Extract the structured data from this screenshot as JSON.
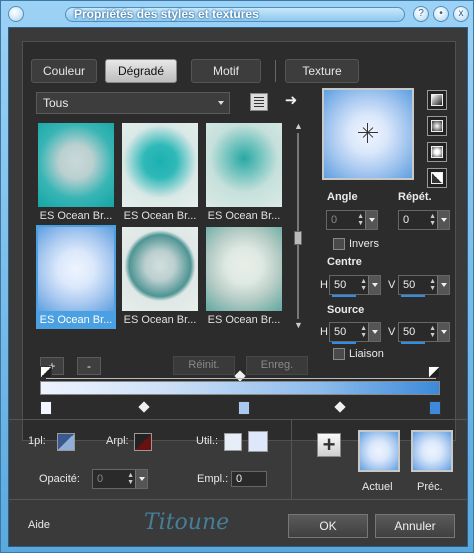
{
  "window": {
    "title": "Propriétés des styles et textures",
    "controls": [
      "help-icon",
      "pin-icon",
      "close-icon"
    ],
    "close_glyph": "x",
    "help_glyph": "?"
  },
  "tabs": [
    {
      "label": "Couleur"
    },
    {
      "label": "Dégradé"
    },
    {
      "label": "Motif"
    },
    {
      "label": "Texture"
    }
  ],
  "active_tab": "Dégradé",
  "category_select": {
    "value": "Tous"
  },
  "gradients": [
    {
      "name": "ES Ocean Br..."
    },
    {
      "name": "ES Ocean Br..."
    },
    {
      "name": "ES Ocean Br..."
    },
    {
      "name": "ES Ocean Br..."
    },
    {
      "name": "ES Ocean Br..."
    },
    {
      "name": "ES Ocean Br..."
    }
  ],
  "selected_gradient_index": 3,
  "angle": {
    "label": "Angle",
    "value": "0"
  },
  "repeat": {
    "label": "Répét.",
    "value": "0"
  },
  "invert": {
    "label": "Invers",
    "checked": false
  },
  "center": {
    "label": "Centre",
    "h_label": "H",
    "h_value": "50",
    "v_label": "V",
    "v_value": "50"
  },
  "source": {
    "label": "Source",
    "h_label": "H",
    "h_value": "50",
    "v_label": "V",
    "v_value": "50"
  },
  "link": {
    "label": "Liaison",
    "checked": false
  },
  "buttons": {
    "add": "+",
    "remove": "-",
    "reset": "Réinit.",
    "save": "Enreg."
  },
  "bottom": {
    "first_plan_label": "1pl:",
    "background_label": "Arpl:",
    "user_label": "Util.:",
    "opacity_label": "Opacité:",
    "opacity_value": "0",
    "location_label": "Empl.:",
    "location_value": "0",
    "current_label": "Actuel",
    "previous_label": "Préc.",
    "help_label": "Aide",
    "ok_label": "OK",
    "cancel_label": "Annuler",
    "plus_glyph": "+",
    "signature": "Titoune"
  },
  "colors": {
    "accent": "#4aa0e0",
    "window_frame": "#6fb6e6",
    "panel_bg": "#2c2c2c",
    "gradient_start": "#eef4ff",
    "gradient_end": "#3c8ad9"
  }
}
